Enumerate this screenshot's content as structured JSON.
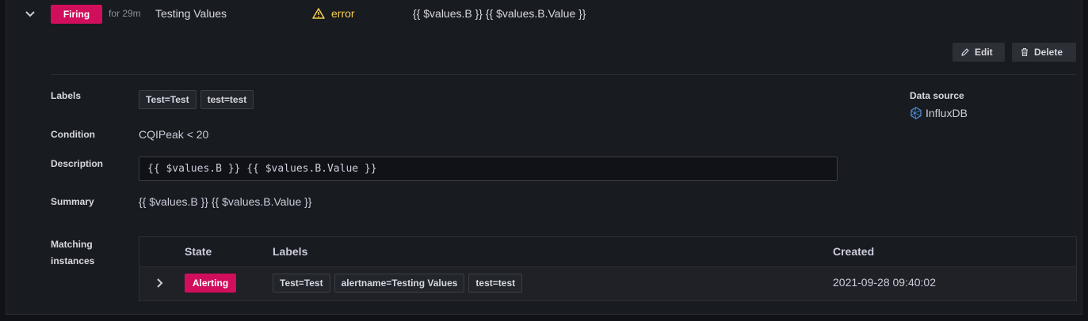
{
  "header": {
    "state": "Firing",
    "duration": "for 29m",
    "rule_name": "Testing Values",
    "health": "error",
    "summary": "{{ $values.B }} {{ $values.B.Value }}"
  },
  "actions": {
    "edit_label": "Edit",
    "delete_label": "Delete"
  },
  "details": {
    "labels_title": "Labels",
    "labels": [
      "Test=Test",
      "test=test"
    ],
    "condition_title": "Condition",
    "condition": "CQIPeak < 20",
    "description_title": "Description",
    "description": "{{ $values.B }} {{ $values.B.Value }}",
    "summary_title": "Summary",
    "summary": "{{ $values.B }} {{ $values.B.Value }}",
    "matching_title_1": "Matching",
    "matching_title_2": "instances"
  },
  "datasource": {
    "title": "Data source",
    "name": "InfluxDB"
  },
  "instances": {
    "columns": {
      "state": "State",
      "labels": "Labels",
      "created": "Created"
    },
    "rows": [
      {
        "state": "Alerting",
        "labels": [
          "Test=Test",
          "alertname=Testing Values",
          "test=test"
        ],
        "created": "2021-09-28 09:40:02"
      }
    ]
  },
  "colors": {
    "firing": "#d10e5c",
    "warning": "#f2cc4f",
    "influx": "#4d8bd4"
  },
  "icons": {
    "expand": "chevron-down-icon",
    "health": "warning-triangle-icon",
    "edit": "pen-icon",
    "delete": "trash-icon",
    "datasource": "influxdb-icon",
    "row_expand": "chevron-right-icon"
  }
}
